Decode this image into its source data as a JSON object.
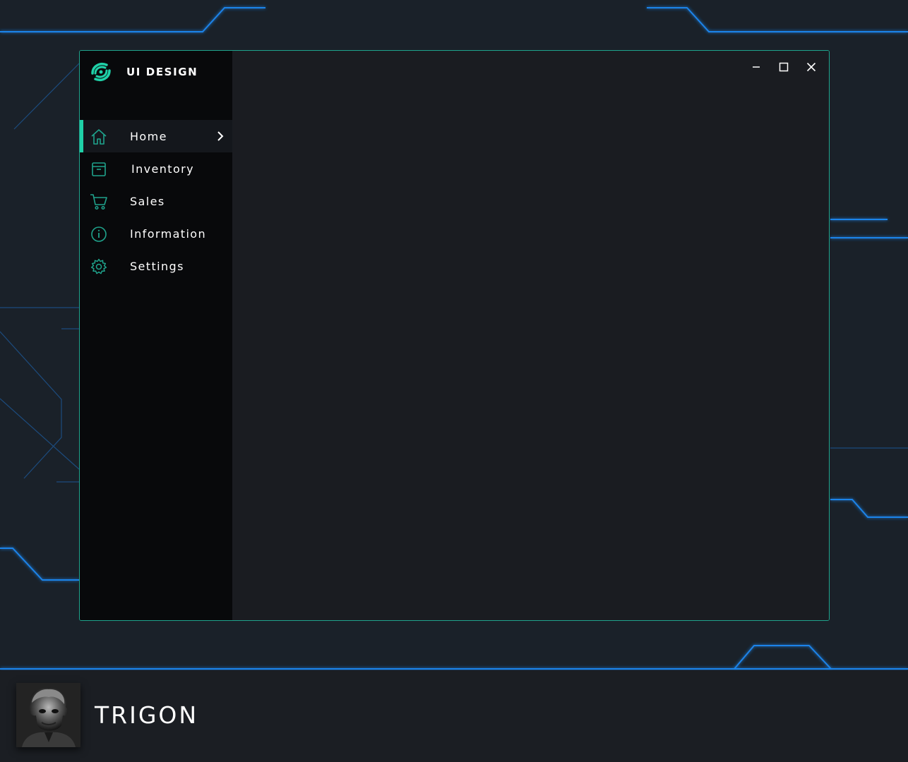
{
  "brand": {
    "title": "UI DESIGN",
    "logo_icon": "swirl-logo-icon"
  },
  "nav": {
    "items": [
      {
        "label": "Home",
        "icon": "home-icon",
        "active": true
      },
      {
        "label": "Inventory",
        "icon": "archive-box-icon",
        "active": false
      },
      {
        "label": "Sales",
        "icon": "shopping-cart-icon",
        "active": false
      },
      {
        "label": "Information",
        "icon": "info-circle-icon",
        "active": false
      },
      {
        "label": "Settings",
        "icon": "gear-icon",
        "active": false
      }
    ]
  },
  "window_controls": [
    "minimize-icon",
    "maximize-icon",
    "close-icon"
  ],
  "footer": {
    "name": "TRIGON",
    "avatar": "joker-portrait"
  },
  "colors": {
    "accent": "#1fd1a8",
    "window_border": "#1fa38c",
    "glow_line": "#1e8fff",
    "background": "#1a2129",
    "sidebar": "#08090b",
    "content": "#1a1c21"
  }
}
